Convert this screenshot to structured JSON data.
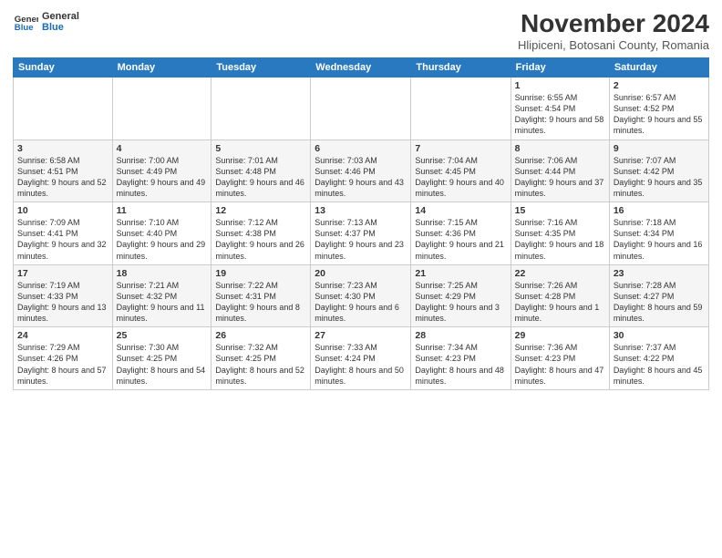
{
  "header": {
    "logo_general": "General",
    "logo_blue": "Blue",
    "month": "November 2024",
    "location": "Hlipiceni, Botosani County, Romania"
  },
  "days_of_week": [
    "Sunday",
    "Monday",
    "Tuesday",
    "Wednesday",
    "Thursday",
    "Friday",
    "Saturday"
  ],
  "weeks": [
    [
      {
        "day": "",
        "info": ""
      },
      {
        "day": "",
        "info": ""
      },
      {
        "day": "",
        "info": ""
      },
      {
        "day": "",
        "info": ""
      },
      {
        "day": "",
        "info": ""
      },
      {
        "day": "1",
        "info": "Sunrise: 6:55 AM\nSunset: 4:54 PM\nDaylight: 9 hours and 58 minutes."
      },
      {
        "day": "2",
        "info": "Sunrise: 6:57 AM\nSunset: 4:52 PM\nDaylight: 9 hours and 55 minutes."
      }
    ],
    [
      {
        "day": "3",
        "info": "Sunrise: 6:58 AM\nSunset: 4:51 PM\nDaylight: 9 hours and 52 minutes."
      },
      {
        "day": "4",
        "info": "Sunrise: 7:00 AM\nSunset: 4:49 PM\nDaylight: 9 hours and 49 minutes."
      },
      {
        "day": "5",
        "info": "Sunrise: 7:01 AM\nSunset: 4:48 PM\nDaylight: 9 hours and 46 minutes."
      },
      {
        "day": "6",
        "info": "Sunrise: 7:03 AM\nSunset: 4:46 PM\nDaylight: 9 hours and 43 minutes."
      },
      {
        "day": "7",
        "info": "Sunrise: 7:04 AM\nSunset: 4:45 PM\nDaylight: 9 hours and 40 minutes."
      },
      {
        "day": "8",
        "info": "Sunrise: 7:06 AM\nSunset: 4:44 PM\nDaylight: 9 hours and 37 minutes."
      },
      {
        "day": "9",
        "info": "Sunrise: 7:07 AM\nSunset: 4:42 PM\nDaylight: 9 hours and 35 minutes."
      }
    ],
    [
      {
        "day": "10",
        "info": "Sunrise: 7:09 AM\nSunset: 4:41 PM\nDaylight: 9 hours and 32 minutes."
      },
      {
        "day": "11",
        "info": "Sunrise: 7:10 AM\nSunset: 4:40 PM\nDaylight: 9 hours and 29 minutes."
      },
      {
        "day": "12",
        "info": "Sunrise: 7:12 AM\nSunset: 4:38 PM\nDaylight: 9 hours and 26 minutes."
      },
      {
        "day": "13",
        "info": "Sunrise: 7:13 AM\nSunset: 4:37 PM\nDaylight: 9 hours and 23 minutes."
      },
      {
        "day": "14",
        "info": "Sunrise: 7:15 AM\nSunset: 4:36 PM\nDaylight: 9 hours and 21 minutes."
      },
      {
        "day": "15",
        "info": "Sunrise: 7:16 AM\nSunset: 4:35 PM\nDaylight: 9 hours and 18 minutes."
      },
      {
        "day": "16",
        "info": "Sunrise: 7:18 AM\nSunset: 4:34 PM\nDaylight: 9 hours and 16 minutes."
      }
    ],
    [
      {
        "day": "17",
        "info": "Sunrise: 7:19 AM\nSunset: 4:33 PM\nDaylight: 9 hours and 13 minutes."
      },
      {
        "day": "18",
        "info": "Sunrise: 7:21 AM\nSunset: 4:32 PM\nDaylight: 9 hours and 11 minutes."
      },
      {
        "day": "19",
        "info": "Sunrise: 7:22 AM\nSunset: 4:31 PM\nDaylight: 9 hours and 8 minutes."
      },
      {
        "day": "20",
        "info": "Sunrise: 7:23 AM\nSunset: 4:30 PM\nDaylight: 9 hours and 6 minutes."
      },
      {
        "day": "21",
        "info": "Sunrise: 7:25 AM\nSunset: 4:29 PM\nDaylight: 9 hours and 3 minutes."
      },
      {
        "day": "22",
        "info": "Sunrise: 7:26 AM\nSunset: 4:28 PM\nDaylight: 9 hours and 1 minute."
      },
      {
        "day": "23",
        "info": "Sunrise: 7:28 AM\nSunset: 4:27 PM\nDaylight: 8 hours and 59 minutes."
      }
    ],
    [
      {
        "day": "24",
        "info": "Sunrise: 7:29 AM\nSunset: 4:26 PM\nDaylight: 8 hours and 57 minutes."
      },
      {
        "day": "25",
        "info": "Sunrise: 7:30 AM\nSunset: 4:25 PM\nDaylight: 8 hours and 54 minutes."
      },
      {
        "day": "26",
        "info": "Sunrise: 7:32 AM\nSunset: 4:25 PM\nDaylight: 8 hours and 52 minutes."
      },
      {
        "day": "27",
        "info": "Sunrise: 7:33 AM\nSunset: 4:24 PM\nDaylight: 8 hours and 50 minutes."
      },
      {
        "day": "28",
        "info": "Sunrise: 7:34 AM\nSunset: 4:23 PM\nDaylight: 8 hours and 48 minutes."
      },
      {
        "day": "29",
        "info": "Sunrise: 7:36 AM\nSunset: 4:23 PM\nDaylight: 8 hours and 47 minutes."
      },
      {
        "day": "30",
        "info": "Sunrise: 7:37 AM\nSunset: 4:22 PM\nDaylight: 8 hours and 45 minutes."
      }
    ]
  ]
}
